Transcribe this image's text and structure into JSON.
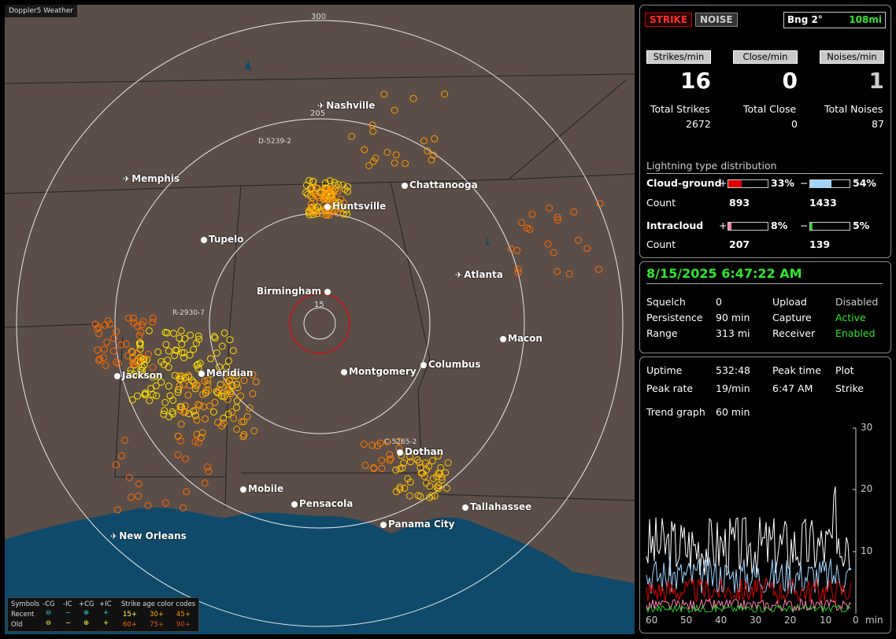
{
  "map": {
    "brand": "Doppler5 Weather",
    "ring_labels": [
      "300",
      "205",
      "15"
    ],
    "cities": [
      {
        "name": "Nashville",
        "kind": "airport"
      },
      {
        "name": "Memphis",
        "kind": "airport"
      },
      {
        "name": "Chattanooga",
        "kind": "dot"
      },
      {
        "name": "Huntsville",
        "kind": "dot"
      },
      {
        "name": "Tupelo",
        "kind": "dot"
      },
      {
        "name": "Atlanta",
        "kind": "airport"
      },
      {
        "name": "Birmingham",
        "kind": "dot"
      },
      {
        "name": "Macon",
        "kind": "dot"
      },
      {
        "name": "Jackson",
        "kind": "dot"
      },
      {
        "name": "Meridian",
        "kind": "dot"
      },
      {
        "name": "Montgomery",
        "kind": "dot"
      },
      {
        "name": "Columbus",
        "kind": "dot"
      },
      {
        "name": "Dothan",
        "kind": "dot"
      },
      {
        "name": "Mobile",
        "kind": "dot"
      },
      {
        "name": "Pensacola",
        "kind": "dot"
      },
      {
        "name": "Tallahassee",
        "kind": "dot"
      },
      {
        "name": "Panama City",
        "kind": "dot"
      },
      {
        "name": "New Orleans",
        "kind": "airport"
      }
    ],
    "tags": [
      "D-5239-2",
      "R-2930-7",
      "C-5265-2"
    ],
    "legend": {
      "symbols": "Symbols",
      "cols": [
        "-CG",
        "-IC",
        "+CG",
        "+IC"
      ],
      "recent": "Recent",
      "old": "Old",
      "age_title": "Strike age color codes",
      "recent_ages": [
        "15+",
        "30+",
        "45+"
      ],
      "old_ages": [
        "60+",
        "75+",
        "90+"
      ]
    }
  },
  "status": {
    "strike_btn": "STRIKE",
    "noise_btn": "NOISE",
    "bearing": "Bng 2°",
    "distance": "108mi",
    "strikes_min_label": "Strikes/min",
    "close_min_label": "Close/min",
    "noises_min_label": "Noises/min",
    "strikes_min": "16",
    "close_min": "0",
    "noises_min": "1",
    "total_strikes_label": "Total Strikes",
    "total_close_label": "Total Close",
    "total_noises_label": "Total Noises",
    "total_strikes": "2672",
    "total_close": "0",
    "total_noises": "87",
    "dist_title": "Lightning type distribution",
    "cg_label": "Cloud-ground",
    "cg_pos_pct": "33%",
    "cg_neg_pct": "54%",
    "count_label": "Count",
    "cg_pos_count": "893",
    "cg_neg_count": "1433",
    "ic_label": "Intracloud",
    "ic_pos_pct": "8%",
    "ic_neg_pct": "5%",
    "ic_pos_count": "207",
    "ic_neg_count": "139",
    "cg_pos_frac": 0.33,
    "cg_neg_frac": 0.54,
    "ic_pos_frac": 0.08,
    "ic_neg_frac": 0.05
  },
  "settings": {
    "datetime": "8/15/2025 6:47:22 AM",
    "squelch_label": "Squelch",
    "squelch": "0",
    "persistence_label": "Persistence",
    "persistence": "90 min",
    "range_label": "Range",
    "range": "313 mi",
    "upload_label": "Upload",
    "upload": "Disabled",
    "capture_label": "Capture",
    "capture": "Active",
    "receiver_label": "Receiver",
    "receiver": "Enabled"
  },
  "stats": {
    "uptime_label": "Uptime",
    "uptime": "532:48",
    "peak_time_label": "Peak time",
    "peak_time": "6:47 AM",
    "plot_label": "Plot",
    "plot": "Strike",
    "peak_rate_label": "Peak rate",
    "peak_rate": "19/min",
    "trend_label": "Trend graph",
    "trend": "60 min",
    "y_ticks": [
      "30",
      "20",
      "10"
    ],
    "x_ticks": [
      "60",
      "50",
      "40",
      "30",
      "20",
      "10",
      "0"
    ],
    "x_unit": "min"
  },
  "colors": {
    "plus_cg": "#e00000",
    "minus_cg": "#9fd4ff",
    "plus_ic": "#ff7fb0",
    "minus_ic": "#22cc22",
    "green": "#2ee82e",
    "map_bg": "#5b4e48",
    "water": "#0f4a6b"
  }
}
